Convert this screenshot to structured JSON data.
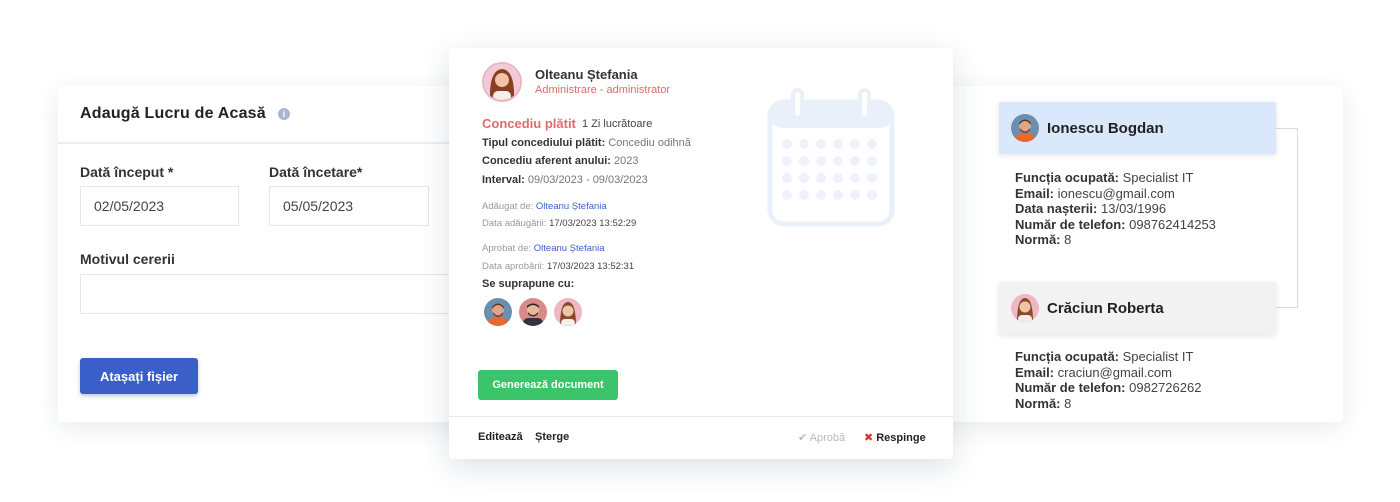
{
  "left_form": {
    "title": "Adaugă Lucru de Acasă",
    "start_label": "Dată început *",
    "start_value": "02/05/2023",
    "end_label": "Dată încetare*",
    "end_value": "05/05/2023",
    "reason_label": "Motivul cererii",
    "reason_value": "",
    "attach_button": "Atașați fișier"
  },
  "leave_card": {
    "name": "Olteanu Ștefania",
    "role": "Administrare - administrator",
    "leave_type": "Concediu plătit",
    "days": "1 Zi lucrătoare",
    "paid_type_label": "Tipul concediului plătit:",
    "paid_type_value": "Concediu odihnă",
    "year_label": "Concediu aferent anului:",
    "year_value": "2023",
    "interval_label": "Interval:",
    "interval_value": "09/03/2023 - 09/03/2023",
    "added_by_label": "Adăugat de:",
    "added_by_value": "Olteanu Ștefania",
    "added_date_label": "Data adăugării:",
    "added_date_value": "17/03/2023 13:52:29",
    "approved_by_label": "Aprobat de:",
    "approved_by_value": "Olteanu Ștefania",
    "approved_date_label": "Data aprobării:",
    "approved_date_value": "17/03/2023 13:52:31",
    "overlap_label": "Se suprapune cu:",
    "generate_button": "Generează document",
    "edit_link": "Editează",
    "delete_link": "Șterge",
    "approve_link": "Aprobă",
    "reject_link": "Respinge",
    "icons": [
      "calendar-icon",
      "check-icon",
      "close-icon"
    ]
  },
  "people": [
    {
      "name": "Ionescu Bogdan",
      "function_label": "Funcția ocupată:",
      "function_value": "Specialist IT",
      "email_label": "Email:",
      "email_value": "ionescu@gmail.com",
      "birth_label": "Data nașterii:",
      "birth_value": "13/03/1996",
      "phone_label": "Număr de telefon:",
      "phone_value": "098762414253",
      "norm_label": "Normă:",
      "norm_value": "8"
    },
    {
      "name": "Crăciun Roberta",
      "function_label": "Funcția ocupată:",
      "function_value": "Specialist IT",
      "email_label": "Email:",
      "email_value": "craciun@gmail.com",
      "phone_label": "Număr de telefon:",
      "phone_value": "0982726262",
      "norm_label": "Normă:",
      "norm_value": "8"
    }
  ],
  "colors": {
    "primary_blue": "#3a5fc8",
    "green": "#3cc46a",
    "accent_red": "#e06b6b",
    "highlight_blue": "#dae8fb"
  }
}
